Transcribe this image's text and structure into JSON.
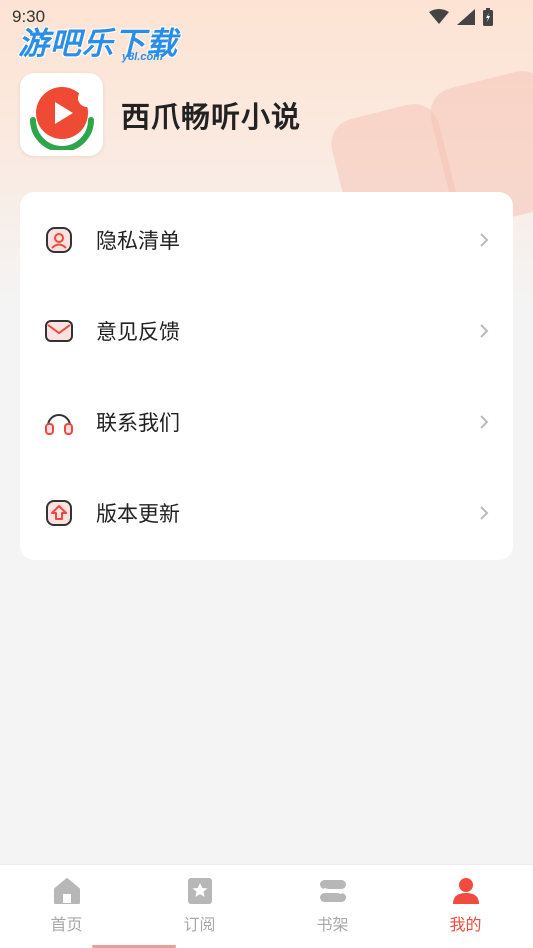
{
  "status_bar": {
    "time": "9:30"
  },
  "watermark": {
    "title": "游吧乐下载",
    "domain": "y8l.com"
  },
  "app": {
    "name": "西爪畅听小说"
  },
  "menu": {
    "items": [
      {
        "label": "隐私清单",
        "icon": "privacy-list-icon"
      },
      {
        "label": "意见反馈",
        "icon": "feedback-mail-icon"
      },
      {
        "label": "联系我们",
        "icon": "headset-icon"
      },
      {
        "label": "版本更新",
        "icon": "update-arrow-icon"
      }
    ]
  },
  "bottom_nav": {
    "items": [
      {
        "label": "首页",
        "icon": "home-icon",
        "active": false
      },
      {
        "label": "订阅",
        "icon": "bookmark-star-icon",
        "active": false
      },
      {
        "label": "书架",
        "icon": "bookshelf-icon",
        "active": false
      },
      {
        "label": "我的",
        "icon": "profile-icon",
        "active": true
      }
    ]
  },
  "colors": {
    "accent": "#f04b3e",
    "inactive": "#a9a9a9",
    "background": "#f4f4f4"
  }
}
